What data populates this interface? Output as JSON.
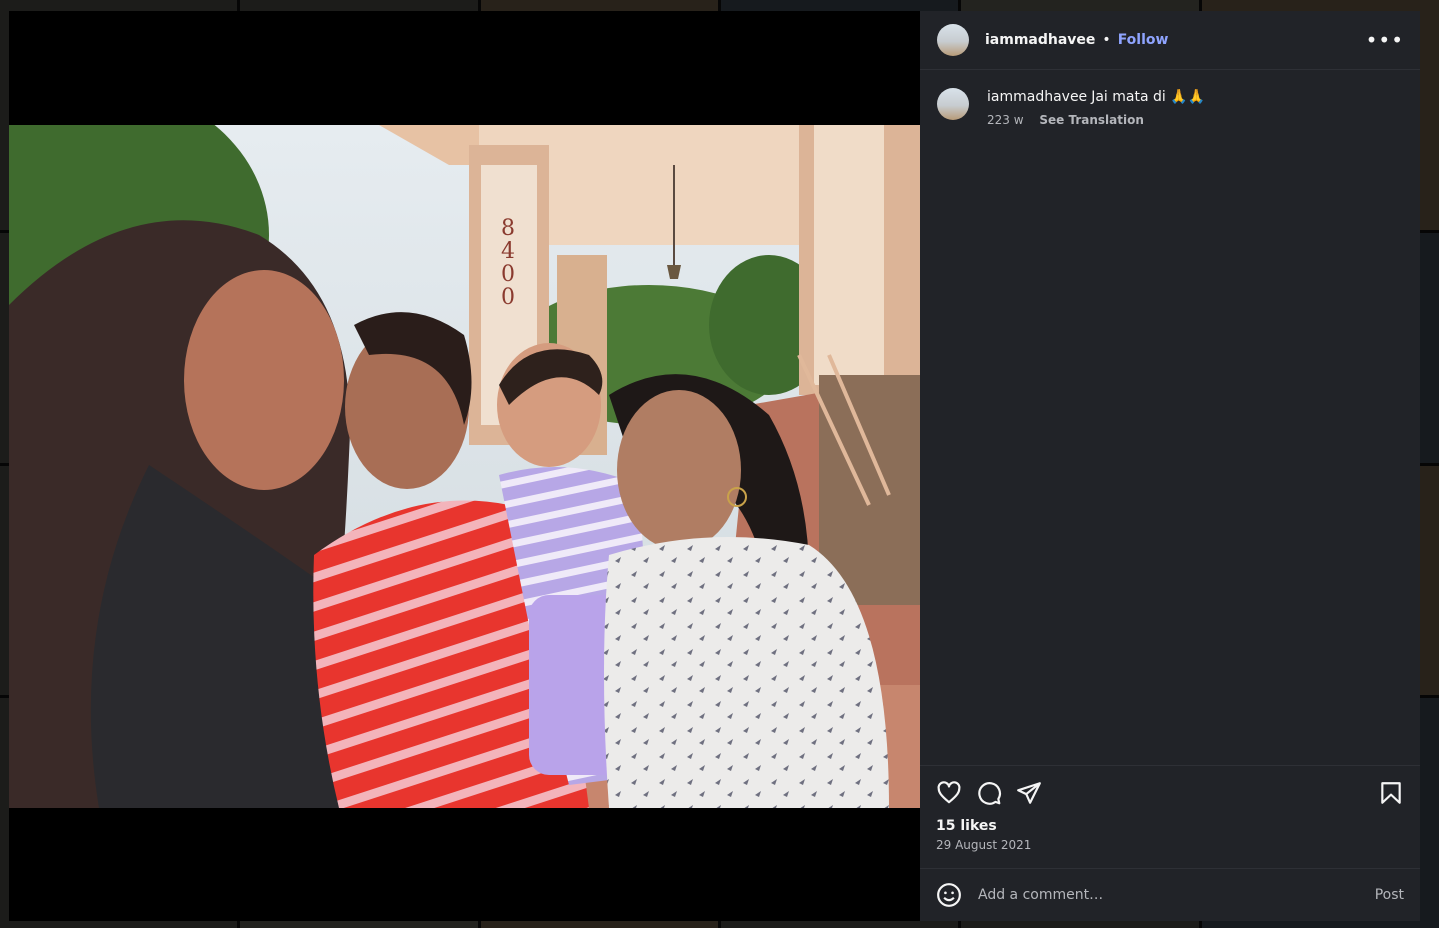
{
  "post": {
    "username": "iammadhavee",
    "separator": "•",
    "follow_label": "Follow",
    "more_label": "•••",
    "caption_user": "iammadhavee",
    "caption_text": "Jai mata di 🙏🙏",
    "caption_age": "223 w",
    "see_translation": "See Translation",
    "likes": "15 likes",
    "date": "29 August 2021",
    "comment_placeholder": "Add a comment…",
    "post_label": "Post",
    "photo_sign_text": "8400"
  },
  "icons": {
    "like": "heart-icon",
    "comment": "comment-icon",
    "share": "send-icon",
    "save": "bookmark-icon",
    "emoji": "emoji-icon",
    "more": "more-icon"
  },
  "colors": {
    "panel_bg": "#212328",
    "follow": "#8fa4ff",
    "muted": "#b4b6bb"
  }
}
